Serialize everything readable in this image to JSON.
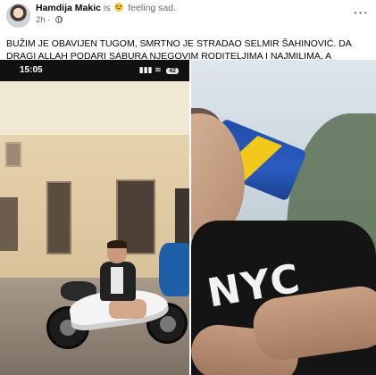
{
  "post": {
    "author": "Hamdija Makic",
    "feeling_prefix": "is",
    "feeling_text": "feeling sad.",
    "time": "2h",
    "dot": "·",
    "more": "···",
    "text": "BUŽIM JE OBAVIJEN TUGOM, SMRTNO JE STRADAO SELMIR ŠAHINOVIĆ. DA DRAGI ALLAH PODARI SABURA NJEGOVIM RODITELJIMA I NAJMILIMA, A NJEMU DŽENET AMIN."
  },
  "story": {
    "status_time": "15:05",
    "status_signal": "▮▮▮ ≋",
    "battery": "42"
  },
  "right_photo": {
    "shirt_text": "NYC"
  },
  "colors": {
    "text_primary": "#050505",
    "text_secondary": "#65676b",
    "flag_blue": "#1f4da8",
    "flag_yellow": "#f2c81b"
  }
}
